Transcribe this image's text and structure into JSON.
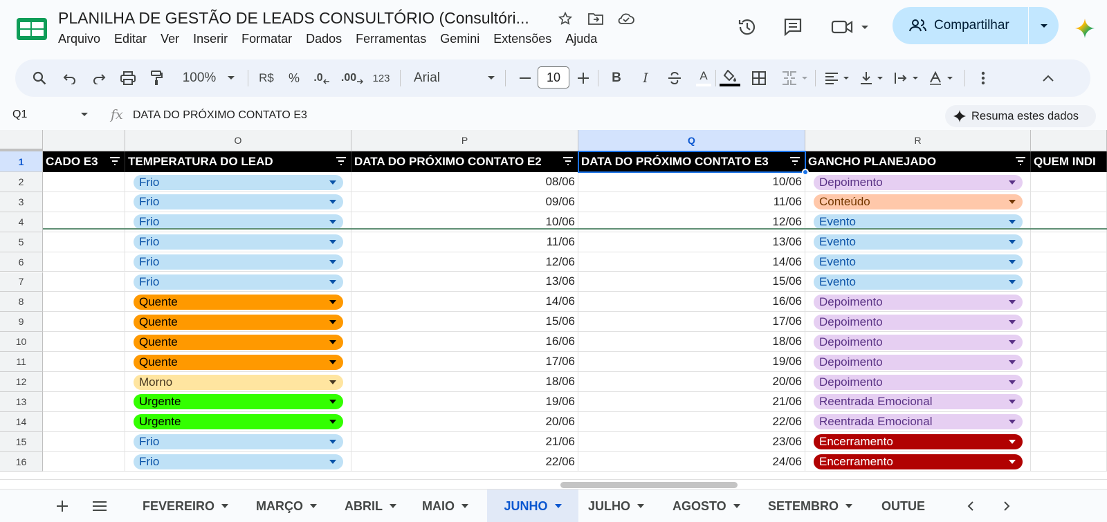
{
  "header": {
    "title": "PLANILHA DE GESTÃO DE LEADS CONSULTÓRIO (Consultóri...",
    "menu": [
      "Arquivo",
      "Editar",
      "Ver",
      "Inserir",
      "Formatar",
      "Dados",
      "Ferramentas",
      "Gemini",
      "Extensões",
      "Ajuda"
    ],
    "share_label": "Compartilhar"
  },
  "toolbar": {
    "zoom": "100%",
    "currency": "R$",
    "percent": "%",
    "dec_decrease": ".0",
    "dec_increase": ".00",
    "number_format": "123",
    "font": "Arial",
    "font_size": "10",
    "bold": "B",
    "italic": "I",
    "text_color": "A"
  },
  "formula_bar": {
    "cell_ref": "Q1",
    "content": "DATA DO PRÓXIMO CONTATO E3",
    "gemini_button": "Resuma estes dados"
  },
  "grid": {
    "columns": [
      "O",
      "P",
      "Q",
      "R"
    ],
    "headers": {
      "left_partial": "CADO E3",
      "O": "TEMPERATURA DO LEAD",
      "P": "DATA DO PRÓXIMO CONTATO E2",
      "Q": "DATA DO PRÓXIMO CONTATO E3",
      "R": "GANCHO PLANEJADO",
      "right_partial": "QUEM INDI"
    },
    "rows": [
      {
        "n": "1"
      },
      {
        "n": "2",
        "temp": "Frio",
        "p": "08/06",
        "q": "10/06",
        "gancho": "Depoimento"
      },
      {
        "n": "3",
        "temp": "Frio",
        "p": "09/06",
        "q": "11/06",
        "gancho": "Conteúdo"
      },
      {
        "n": "4",
        "temp": "Frio",
        "p": "10/06",
        "q": "12/06",
        "gancho": "Evento"
      },
      {
        "n": "5",
        "temp": "Frio",
        "p": "11/06",
        "q": "13/06",
        "gancho": "Evento"
      },
      {
        "n": "6",
        "temp": "Frio",
        "p": "12/06",
        "q": "14/06",
        "gancho": "Evento"
      },
      {
        "n": "7",
        "temp": "Frio",
        "p": "13/06",
        "q": "15/06",
        "gancho": "Evento"
      },
      {
        "n": "8",
        "temp": "Quente",
        "p": "14/06",
        "q": "16/06",
        "gancho": "Depoimento"
      },
      {
        "n": "9",
        "temp": "Quente",
        "p": "15/06",
        "q": "17/06",
        "gancho": "Depoimento"
      },
      {
        "n": "10",
        "temp": "Quente",
        "p": "16/06",
        "q": "18/06",
        "gancho": "Depoimento"
      },
      {
        "n": "11",
        "temp": "Quente",
        "p": "17/06",
        "q": "19/06",
        "gancho": "Depoimento"
      },
      {
        "n": "12",
        "temp": "Morno",
        "p": "18/06",
        "q": "20/06",
        "gancho": "Depoimento"
      },
      {
        "n": "13",
        "temp": "Urgente",
        "p": "19/06",
        "q": "21/06",
        "gancho": "Reentrada Emocional"
      },
      {
        "n": "14",
        "temp": "Urgente",
        "p": "20/06",
        "q": "22/06",
        "gancho": "Reentrada Emocional"
      },
      {
        "n": "15",
        "temp": "Frio",
        "p": "21/06",
        "q": "23/06",
        "gancho": "Encerramento"
      },
      {
        "n": "16",
        "temp": "Frio",
        "p": "22/06",
        "q": "24/06",
        "gancho": "Encerramento"
      }
    ]
  },
  "chip_colors": {
    "Frio": {
      "bg": "#bfe1f6",
      "fg": "#0a53a8",
      "arrow": "#0a53a8"
    },
    "Quente": {
      "bg": "#ff9900",
      "fg": "#000000",
      "arrow": "#000000"
    },
    "Morno": {
      "bg": "#ffe5a0",
      "fg": "#473821",
      "arrow": "#473821"
    },
    "Urgente": {
      "bg": "#33ff00",
      "fg": "#000000",
      "arrow": "#000000"
    },
    "Depoimento": {
      "bg": "#e6cff2",
      "fg": "#5a3286",
      "arrow": "#5a3286"
    },
    "Conteúdo": {
      "bg": "#ffc8aa",
      "fg": "#753800",
      "arrow": "#753800"
    },
    "Evento": {
      "bg": "#bfe1f6",
      "fg": "#0a53a8",
      "arrow": "#0a53a8"
    },
    "Reentrada Emocional": {
      "bg": "#e6cff2",
      "fg": "#5a3286",
      "arrow": "#5a3286"
    },
    "Encerramento": {
      "bg": "#b10202",
      "fg": "#ffffff",
      "arrow": "#ffffff"
    }
  },
  "sheet_tabs": [
    "FEVEREIRO",
    "MARÇO",
    "ABRIL",
    "MAIO",
    "JUNHO",
    "JULHO",
    "AGOSTO",
    "SETEMBRO",
    "OUTUE"
  ],
  "active_tab": "JUNHO"
}
